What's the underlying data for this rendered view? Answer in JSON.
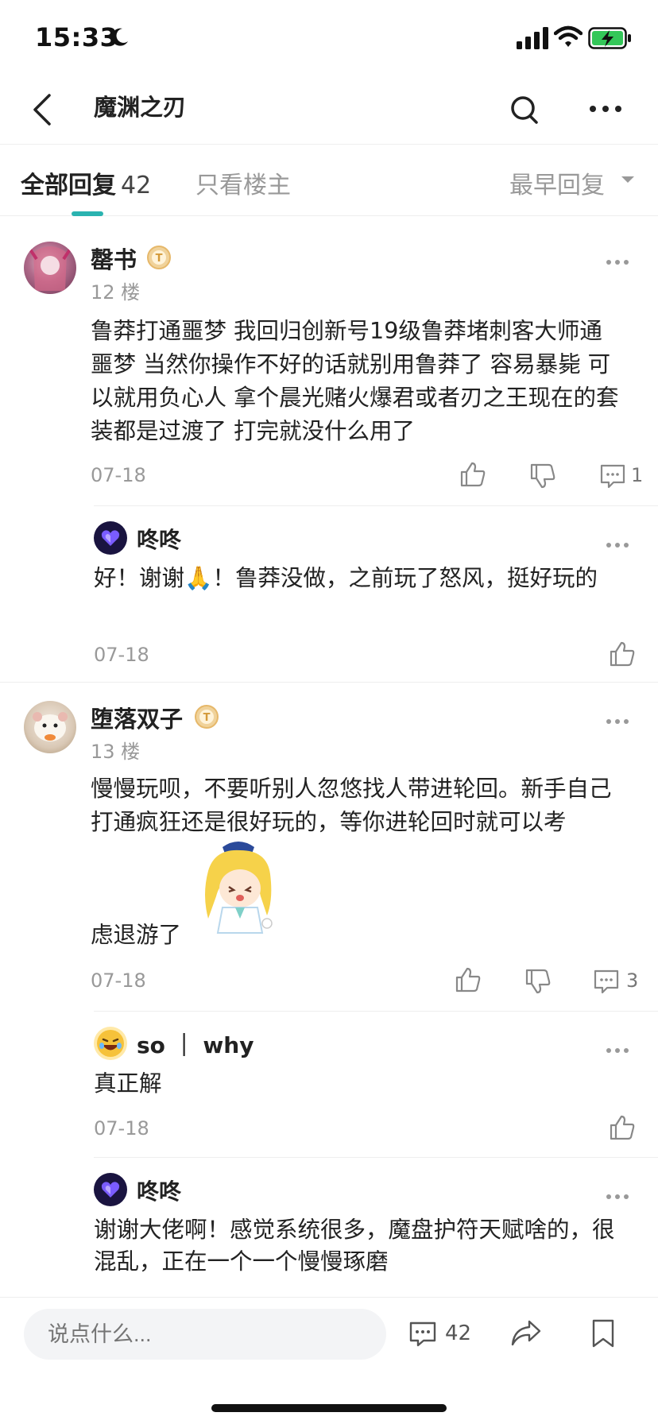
{
  "status_bar": {
    "time": "15:33"
  },
  "nav": {
    "title": "魔渊之刃"
  },
  "tabs": {
    "all_label": "全部回复",
    "all_count": "42",
    "op_only_label": "只看楼主",
    "sort_label": "最早回复"
  },
  "posts": [
    {
      "username": "罄书",
      "floor": "12 楼",
      "content": "鲁莽打通噩梦 我回归创新号19级鲁莽堵刺客大师通噩梦 当然你操作不好的话就别用鲁莽了 容易暴毙 可以就用负心人 拿个晨光赌火爆君或者刃之王现在的套装都是过渡了 打完就没什么用了",
      "date": "07-18",
      "reply_count": "1",
      "replies": [
        {
          "username": "咚咚",
          "content": "好！谢谢🙏！鲁莽没做，之前玩了怒风，挺好玩的",
          "date": "07-18"
        }
      ]
    },
    {
      "username": "堕落双子",
      "floor": "13 楼",
      "content_line1": "慢慢玩呗，不要听别人忽悠找人带进轮回。新手自己打通疯狂还是很好玩的，等你进轮回时就可以考",
      "content_line2": "虑退游了",
      "date": "07-18",
      "reply_count": "3",
      "replies": [
        {
          "username": "so ｜ why",
          "content": "真正解",
          "date": "07-18"
        },
        {
          "username": "咚咚",
          "content": "谢谢大佬啊！感觉系统很多，魔盘护符天赋啥的，很混乱，正在一个一个慢慢琢磨"
        }
      ]
    }
  ],
  "bottom_bar": {
    "input_placeholder": "说点什么...",
    "comment_count": "42"
  },
  "colors": {
    "accent": "#2ab3b0",
    "badge_gold": "#e6b86a",
    "muted_text": "#999999"
  }
}
